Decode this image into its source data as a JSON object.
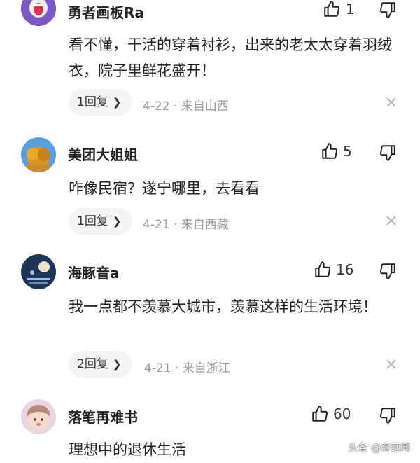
{
  "comments": [
    {
      "username": "勇者画板Ra",
      "likes": "1",
      "content": "看不懂，干活的穿着衬衫，出来的老太太穿着羽绒衣，院子里鲜花盛开！",
      "reply_label": "1回复",
      "meta": "4-22 · 来自山西"
    },
    {
      "username": "美团大姐姐",
      "likes": "5",
      "content": "咋像民宿？遂宁哪里，去看看",
      "reply_label": "1回复",
      "meta": "4-21 · 来自西藏"
    },
    {
      "username": "海豚音a",
      "likes": "16",
      "content": "我一点都不羡慕大城市，羡慕这样的生活环境！",
      "reply_label": "2回复",
      "meta": "4-21 · 来自浙江"
    },
    {
      "username": "落笔再难书",
      "likes": "60",
      "content": "理想中的退休生活"
    }
  ],
  "watermark": "头条 @奇葩闻",
  "colors": {
    "text": "#222222",
    "meta": "#999999",
    "reply_bg": "#f4f4f4"
  },
  "icons": [
    "thumbs-up-icon",
    "thumbs-down-icon",
    "close-icon",
    "chevron-right-icon"
  ]
}
